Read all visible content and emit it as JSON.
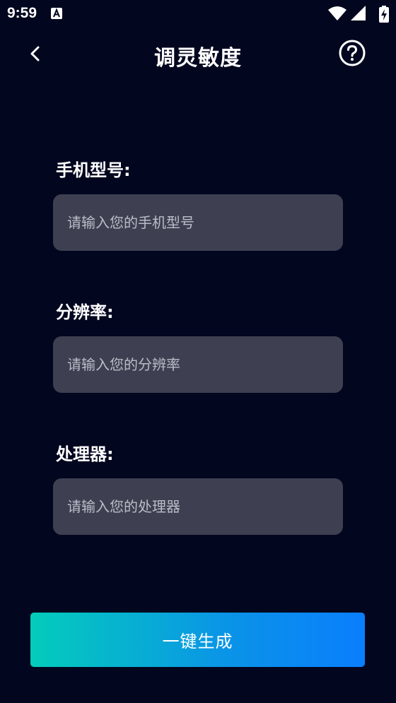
{
  "status_bar": {
    "time": "9:59",
    "icons": [
      "app-notification-icon",
      "wifi-icon",
      "signal-icon",
      "battery-charging-icon"
    ]
  },
  "header": {
    "title": "调灵敏度",
    "back_icon": "chevron-left-icon",
    "help_icon": "question-circle-icon"
  },
  "form": {
    "fields": [
      {
        "label": "手机型号:",
        "placeholder": "请输入您的手机型号",
        "value": ""
      },
      {
        "label": "分辨率:",
        "placeholder": "请输入您的分辨率",
        "value": ""
      },
      {
        "label": "处理器:",
        "placeholder": "请输入您的处理器",
        "value": ""
      }
    ]
  },
  "actions": {
    "generate_label": "一键生成"
  },
  "colors": {
    "background": "#03061f",
    "input_background": "#3e4051",
    "button_gradient_start": "#04ccbb",
    "button_gradient_end": "#0a7efd"
  }
}
